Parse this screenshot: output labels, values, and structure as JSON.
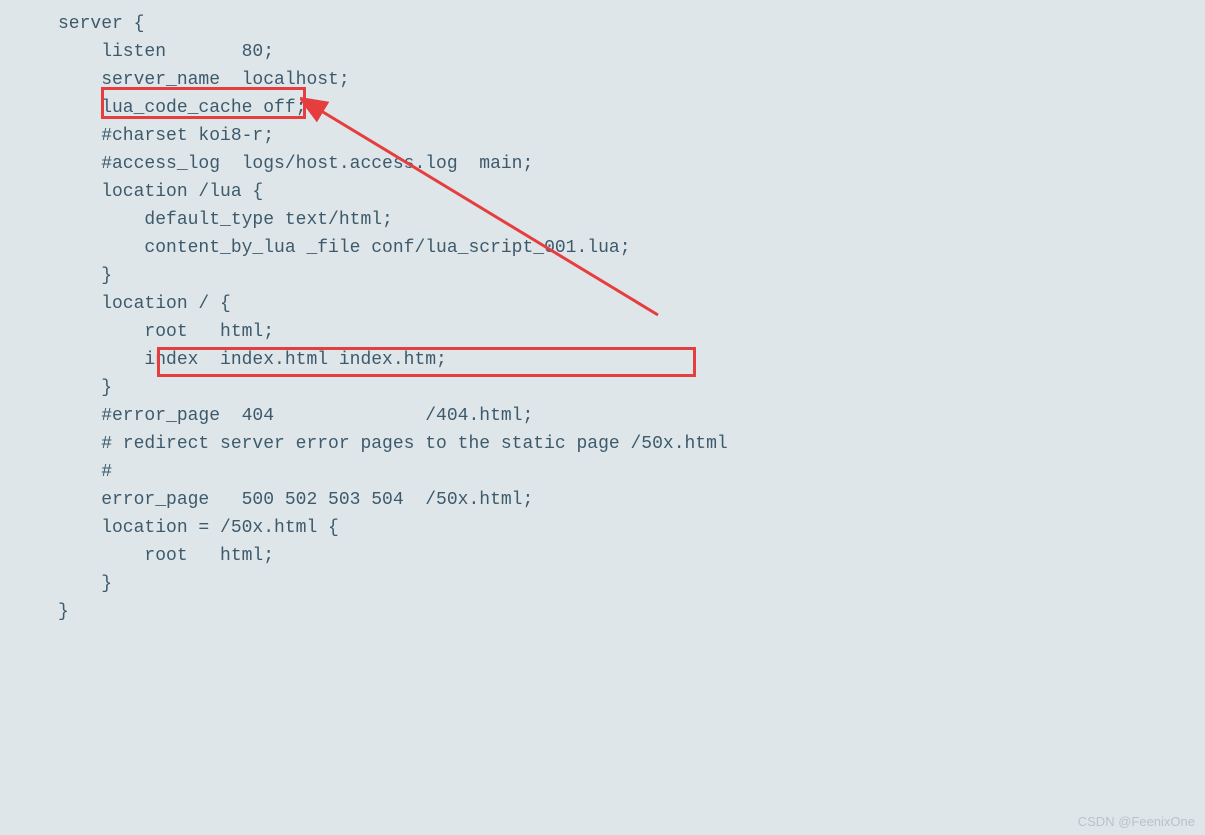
{
  "code": {
    "lines": [
      "server {",
      "    listen       80;",
      "    server_name  localhost;",
      "    lua_code_cache off;",
      "",
      "    #charset koi8-r;",
      "",
      "    #access_log  logs/host.access.log  main;",
      "",
      "    location /lua {",
      "        default_type text/html;",
      "        content_by_lua _file conf/lua_script_001.lua;",
      "    }",
      "",
      "    location / {",
      "        root   html;",
      "        index  index.html index.htm;",
      "    }",
      "",
      "    #error_page  404              /404.html;",
      "",
      "    # redirect server error pages to the static page /50x.html",
      "    #",
      "    error_page   500 502 503 504  /50x.html;",
      "    location = /50x.html {",
      "        root   html;",
      "    }",
      "}"
    ]
  },
  "annotations": {
    "highlight1_target": "lua_code_cache off;",
    "highlight2_target": "content_by_lua _file conf/lua_script_001.lua;",
    "arrow_color": "#e63e3e"
  },
  "watermark": "CSDN @FeenixOne"
}
